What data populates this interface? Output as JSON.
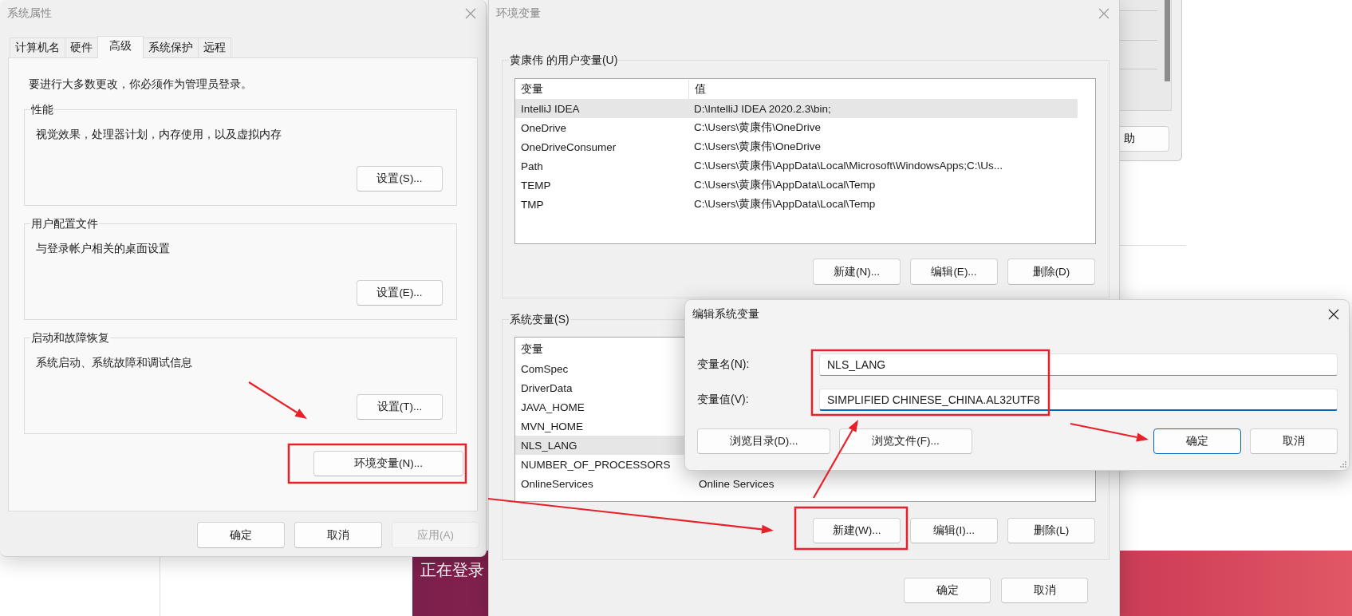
{
  "background": {
    "back_window_button": "助",
    "banner_text": "正在登录"
  },
  "system_properties": {
    "title": "系统属性",
    "tabs": [
      {
        "label": "计算机名",
        "selected": false
      },
      {
        "label": "硬件",
        "selected": false
      },
      {
        "label": "高级",
        "selected": true
      },
      {
        "label": "系统保护",
        "selected": false
      },
      {
        "label": "远程",
        "selected": false
      }
    ],
    "notice": "要进行大多数更改，你必须作为管理员登录。",
    "groups": [
      {
        "title": "性能",
        "description": "视觉效果，处理器计划，内存使用，以及虚拟内存",
        "button": "设置(S)..."
      },
      {
        "title": "用户配置文件",
        "description": "与登录帐户相关的桌面设置",
        "button": "设置(E)..."
      },
      {
        "title": "启动和故障恢复",
        "description": "系统启动、系统故障和调试信息",
        "button": "设置(T)..."
      }
    ],
    "env_button": "环境变量(N)...",
    "buttons": [
      {
        "label": "确定",
        "disabled": false
      },
      {
        "label": "取消",
        "disabled": false
      },
      {
        "label": "应用(A)",
        "disabled": true
      }
    ]
  },
  "environment_variables": {
    "title": "环境变量",
    "user_variables": {
      "title": "黄康伟 的用户变量(U)",
      "columns": [
        "变量",
        "值"
      ],
      "rows": [
        {
          "name": "IntelliJ IDEA",
          "value": "D:\\IntelliJ IDEA 2020.2.3\\bin;",
          "selected": true
        },
        {
          "name": "OneDrive",
          "value": "C:\\Users\\黄康伟\\OneDrive",
          "selected": false
        },
        {
          "name": "OneDriveConsumer",
          "value": "C:\\Users\\黄康伟\\OneDrive",
          "selected": false
        },
        {
          "name": "Path",
          "value": "C:\\Users\\黄康伟\\AppData\\Local\\Microsoft\\WindowsApps;C:\\Us...",
          "selected": false
        },
        {
          "name": "TEMP",
          "value": "C:\\Users\\黄康伟\\AppData\\Local\\Temp",
          "selected": false
        },
        {
          "name": "TMP",
          "value": "C:\\Users\\黄康伟\\AppData\\Local\\Temp",
          "selected": false
        }
      ],
      "buttons": [
        "新建(N)...",
        "编辑(E)...",
        "删除(D)"
      ]
    },
    "system_variables": {
      "title": "系统变量(S)",
      "columns": [
        "变量"
      ],
      "rows": [
        {
          "name": "ComSpec",
          "selected": false
        },
        {
          "name": "DriverData",
          "selected": false
        },
        {
          "name": "JAVA_HOME",
          "selected": false
        },
        {
          "name": "MVN_HOME",
          "selected": false
        },
        {
          "name": "NLS_LANG",
          "selected": true
        },
        {
          "name": "NUMBER_OF_PROCESSORS",
          "selected": false
        },
        {
          "name": "OnlineServices",
          "value": "Online Services",
          "selected": false
        }
      ],
      "buttons": [
        "新建(W)...",
        "编辑(I)...",
        "删除(L)"
      ]
    },
    "buttons": [
      "确定",
      "取消"
    ]
  },
  "edit_dialog": {
    "title": "编辑系统变量",
    "fields": [
      {
        "label": "变量名(N):",
        "value": "NLS_LANG",
        "focused": false
      },
      {
        "label": "变量值(V):",
        "value": "SIMPLIFIED CHINESE_CHINA.AL32UTF8",
        "focused": true
      }
    ],
    "buttons": [
      {
        "label": "浏览目录(D)...",
        "primary": false
      },
      {
        "label": "浏览文件(F)...",
        "primary": false
      },
      {
        "label": "确定",
        "primary": true
      },
      {
        "label": "取消",
        "primary": false
      }
    ]
  }
}
